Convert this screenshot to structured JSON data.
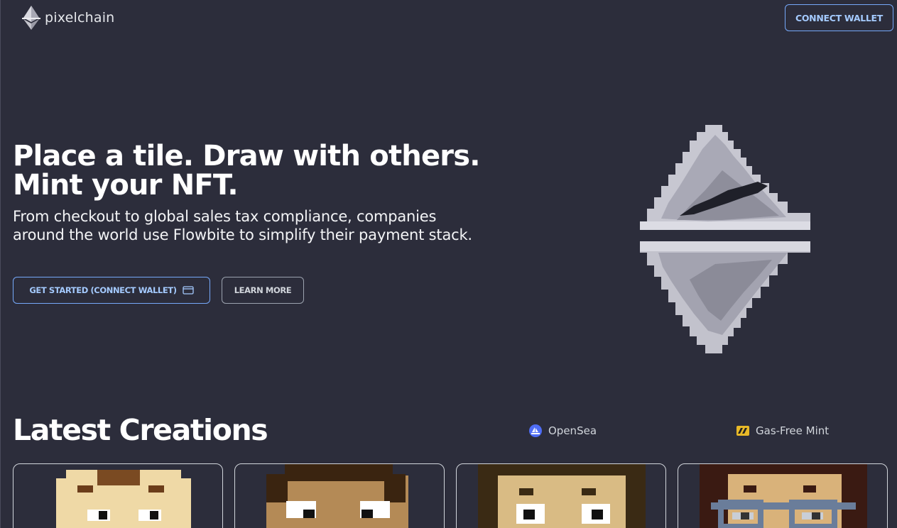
{
  "header": {
    "brand": "pixelchain",
    "connect_label": "CONNECT WALLET"
  },
  "hero": {
    "title_line1": "Place a tile. Draw with others.",
    "title_line2": "Mint your NFT.",
    "subtitle": "From checkout to global sales tax compliance, companies around the world use Flowbite to simplify their payment stack.",
    "primary_cta": "GET STARTED (CONNECT WALLET)",
    "secondary_cta": "LEARN MORE"
  },
  "creations": {
    "title": "Latest Creations",
    "partners": [
      {
        "label": "OpenSea",
        "icon": "opensea-icon"
      },
      {
        "label": "Gas-Free Mint",
        "icon": "gas-free-icon"
      }
    ],
    "cards": [
      {
        "name": "nft-card-1"
      },
      {
        "name": "nft-card-2"
      },
      {
        "name": "nft-card-3"
      },
      {
        "name": "nft-card-4"
      }
    ]
  },
  "colors": {
    "background": "#2c2d3b",
    "accent": "#76a9fa",
    "accent_text": "#a4cafe"
  }
}
